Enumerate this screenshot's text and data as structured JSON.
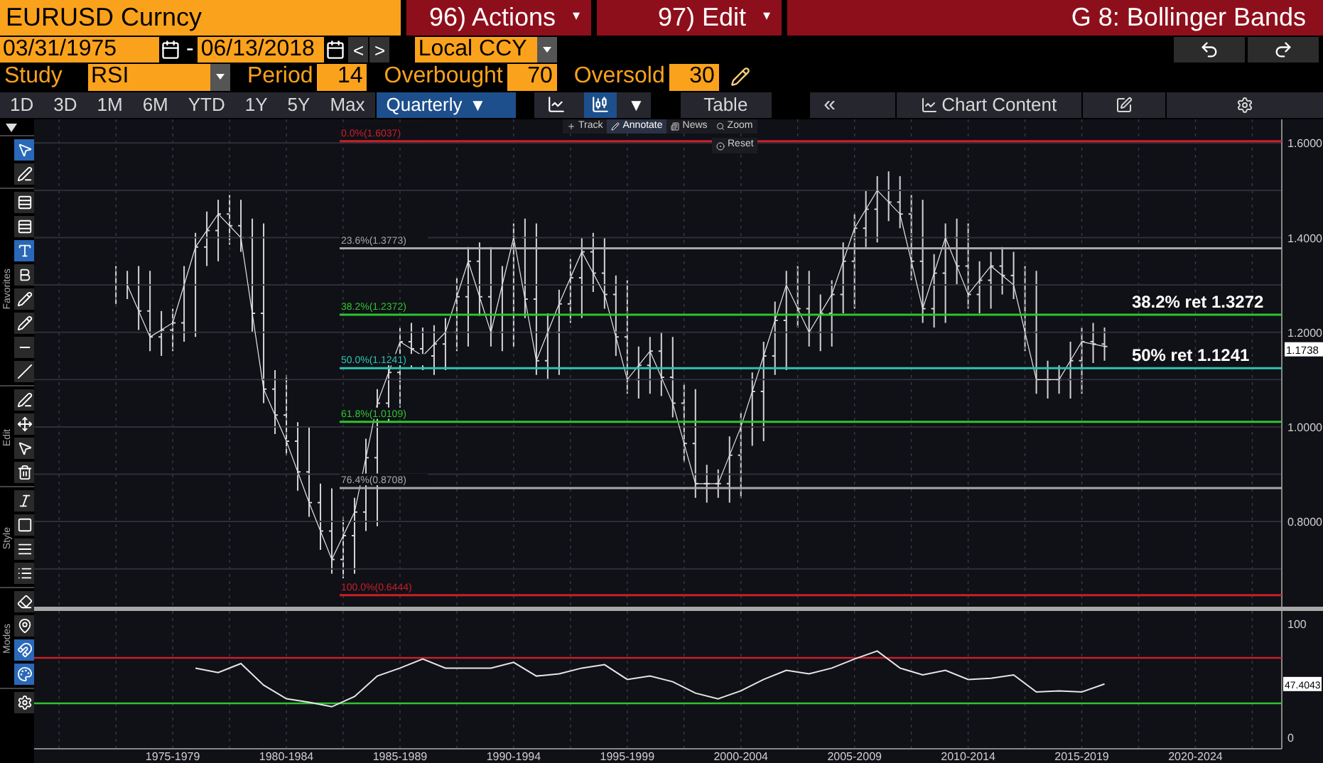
{
  "header": {
    "security": "EURUSD Curncy",
    "menus": [
      {
        "label": "96) Actions",
        "arrow": "▾"
      },
      {
        "label": "97) Edit",
        "arrow": "▾"
      }
    ],
    "title": "G 8: Bollinger Bands"
  },
  "dates": {
    "start": "03/31/1975",
    "separator": "-",
    "end": "06/13/2018",
    "prev": "<",
    "next": ">",
    "currency": "Local CCY"
  },
  "study": {
    "label": "Study",
    "value": "RSI",
    "params": [
      {
        "label": "Period",
        "value": "14"
      },
      {
        "label": "Overbought",
        "value": "70"
      },
      {
        "label": "Oversold",
        "value": "30"
      }
    ]
  },
  "ranges": [
    {
      "label": "1D",
      "selected": false
    },
    {
      "label": "3D",
      "selected": false
    },
    {
      "label": "1M",
      "selected": false
    },
    {
      "label": "6M",
      "selected": false
    },
    {
      "label": "YTD",
      "selected": false
    },
    {
      "label": "1Y",
      "selected": false
    },
    {
      "label": "5Y",
      "selected": false
    },
    {
      "label": "Max",
      "selected": false
    }
  ],
  "frequency": {
    "label": "Quarterly",
    "arrow": "▼",
    "selected": true
  },
  "chart_types": [
    {
      "kind": "line",
      "selected": false
    },
    {
      "kind": "bar",
      "selected": true
    }
  ],
  "chart_type_arrow": "▼",
  "table": "Table",
  "collapse": "«",
  "chart_content": "Chart Content",
  "sidebar": [
    {
      "tools": [
        {
          "kind": "pointer",
          "selected": true
        },
        {
          "kind": "draw",
          "selected": false
        }
      ]
    },
    {
      "label": "Favorites",
      "tools": [
        {
          "kind": "levels",
          "selected": false
        },
        {
          "kind": "levels",
          "selected": false
        },
        {
          "kind": "text",
          "selected": true
        },
        {
          "kind": "bold",
          "selected": false
        },
        {
          "kind": "pen",
          "selected": false
        },
        {
          "kind": "pen",
          "selected": false
        },
        {
          "kind": "hline",
          "selected": false
        },
        {
          "kind": "channel",
          "selected": false
        }
      ]
    },
    {
      "label": "Edit",
      "tools": [
        {
          "kind": "draw",
          "selected": false
        },
        {
          "kind": "move",
          "selected": false
        },
        {
          "kind": "pointer",
          "selected": false
        },
        {
          "kind": "trash",
          "selected": false
        }
      ]
    },
    {
      "label": "Style",
      "tools": [
        {
          "kind": "font",
          "selected": false
        },
        {
          "kind": "fill",
          "selected": false
        },
        {
          "kind": "weight",
          "selected": false
        },
        {
          "kind": "list",
          "selected": false
        }
      ]
    },
    {
      "label": "Modes",
      "tools": [
        {
          "kind": "eraser",
          "selected": false
        },
        {
          "kind": "pin",
          "selected": false
        },
        {
          "kind": "magnet",
          "selected": true
        },
        {
          "kind": "palette",
          "selected": true
        }
      ]
    },
    {
      "tools": [
        {
          "kind": "settings",
          "selected": false
        }
      ]
    }
  ],
  "chart_toolbar": [
    {
      "kind": "track",
      "label": "Track",
      "selected": false
    },
    {
      "kind": "annotate",
      "label": "Annotate",
      "selected": true
    },
    {
      "kind": "news",
      "label": "News",
      "selected": false
    },
    {
      "kind": "zoom",
      "label": "Zoom",
      "selected": false
    }
  ],
  "reset": "Reset",
  "price_chart": {
    "chart_data": {
      "type": "line",
      "grid": true,
      "ylim": [
        0.62,
        1.65
      ],
      "yticks": [
        {
          "value": 0.8,
          "label": "0.8000"
        },
        {
          "value": 1.0,
          "label": "1.0000"
        },
        {
          "value": 1.2,
          "label": "1.2000"
        },
        {
          "value": 1.4,
          "label": "1.4000"
        },
        {
          "value": 1.6,
          "label": "1.6000"
        }
      ],
      "categories": [
        null,
        null,
        null,
        null,
        null,
        null,
        null,
        null,
        null,
        null,
        null,
        null,
        null,
        null,
        null,
        null,
        null,
        null,
        null,
        null,
        null,
        null,
        null,
        null,
        null,
        null,
        null,
        null,
        null,
        null,
        null,
        null,
        null,
        null,
        null,
        null,
        null,
        null,
        null,
        null,
        null,
        null,
        null,
        null,
        null,
        null,
        null,
        null,
        null,
        null,
        null
      ],
      "series": [
        {
          "color": "#e6e6e6",
          "values": [
            1.3,
            1.19,
            1.22,
            1.38,
            1.45,
            1.4,
            1.08,
            0.97,
            0.84,
            0.72,
            0.82,
            1.05,
            1.18,
            1.15,
            1.2,
            1.35,
            1.2,
            1.4,
            1.14,
            1.26,
            1.37,
            1.28,
            1.1,
            1.16,
            1.05,
            0.88,
            0.88,
            1.0,
            1.15,
            1.3,
            1.2,
            1.28,
            1.42,
            1.5,
            1.45,
            1.25,
            1.4,
            1.28,
            1.34,
            1.3,
            1.1,
            1.1,
            1.18,
            1.17,
            null,
            null,
            null,
            null,
            null,
            null,
            null
          ]
        }
      ],
      "ref_lines": [
        {
          "axis": "y",
          "label": "0.0%(1.6037)",
          "value": 1.6037,
          "color": "#c8202a"
        },
        {
          "axis": "y",
          "label": "23.6%(1.3773)",
          "value": 1.3773,
          "color": "#a8a8a8"
        },
        {
          "axis": "y",
          "label": "38.2%(1.2372)",
          "value": 1.2372,
          "color": "#2fc42f"
        },
        {
          "axis": "y",
          "label": "50.0%(1.1241)",
          "value": 1.1241,
          "color": "#2ec4b0"
        },
        {
          "axis": "y",
          "label": "61.8%(1.0109)",
          "value": 1.0109,
          "color": "#2fc42f"
        },
        {
          "axis": "y",
          "label": "76.4%(0.8708)",
          "value": 0.8708,
          "color": "#a8a8a8"
        },
        {
          "axis": "y",
          "label": "100.0%(0.6444)",
          "value": 0.6444,
          "color": "#c8202a"
        }
      ],
      "annotations": [
        "38.2% ret 1.3272",
        "50% ret 1.1241",
        "1.1738"
      ]
    }
  },
  "rsi_chart": {
    "chart_data": {
      "type": "line",
      "grid": true,
      "ylim": [
        -10,
        111.25
      ],
      "yticks": [
        0,
        100
      ],
      "categories": [
        null,
        null,
        "1975-1979",
        null,
        null,
        null,
        null,
        "1980-1984",
        null,
        null,
        null,
        null,
        "1985-1989",
        null,
        null,
        null,
        null,
        "1990-1994",
        null,
        null,
        null,
        null,
        "1995-1999",
        null,
        null,
        null,
        null,
        "2000-2004",
        null,
        null,
        null,
        null,
        "2005-2009",
        null,
        null,
        null,
        null,
        "2010-2014",
        null,
        null,
        null,
        null,
        "2015-2019",
        null,
        null,
        null,
        null,
        "2020-2024",
        null,
        null,
        null
      ],
      "series": [
        {
          "color": "#e6e6e6",
          "values": [
            null,
            null,
            null,
            61,
            57,
            65,
            46,
            34,
            31,
            27,
            36,
            54,
            61,
            69,
            61,
            61,
            61,
            66,
            54,
            56,
            61,
            64,
            51,
            54,
            49,
            39,
            34,
            41,
            51,
            59,
            56,
            61,
            69,
            76,
            61,
            55,
            59,
            51,
            52,
            55,
            40,
            41,
            40,
            47,
            null,
            null,
            null,
            null,
            null,
            null,
            null
          ]
        }
      ],
      "ref_lines": [
        {
          "axis": "y",
          "value": 70,
          "color": "#c8202a"
        },
        {
          "axis": "y",
          "value": 30,
          "color": "#2fc42f"
        }
      ],
      "annotations": [
        "47.4043"
      ]
    }
  }
}
